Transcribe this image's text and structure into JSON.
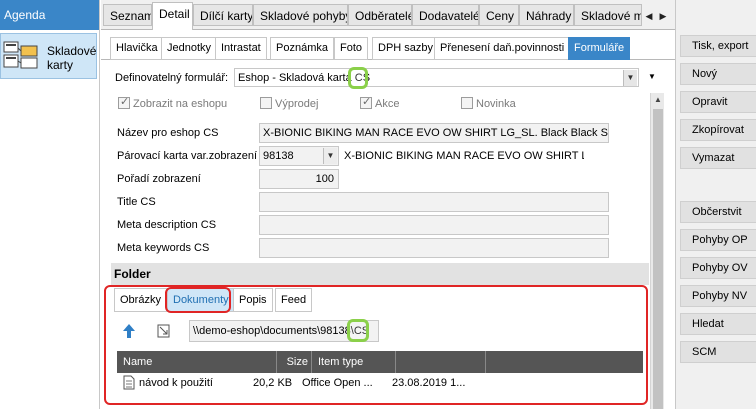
{
  "agenda": {
    "title": "Agenda",
    "item_label_line1": "Skladové",
    "item_label_line2": "karty"
  },
  "top_tabs": [
    {
      "label": "Seznam"
    },
    {
      "label": "Detail"
    },
    {
      "label": "Dílčí karty"
    },
    {
      "label": "Skladové pohyby"
    },
    {
      "label": "Odběratelé"
    },
    {
      "label": "Dodavatelé"
    },
    {
      "label": "Ceny"
    },
    {
      "label": "Náhrady"
    },
    {
      "label": "Skladové me"
    }
  ],
  "sub_tabs": [
    {
      "label": "Hlavička"
    },
    {
      "label": "Jednotky"
    },
    {
      "label": "Intrastat"
    },
    {
      "label": "Poznámka"
    },
    {
      "label": "Foto"
    },
    {
      "label": "DPH sazby"
    },
    {
      "label": "Přenesení daň.povinnosti"
    },
    {
      "label": "Formuláře"
    }
  ],
  "form": {
    "definable_form_label": "Definovatelný formulář:",
    "definable_form_value": "Eshop - Skladová karta CS",
    "checkboxes": [
      {
        "label": "Zobrazit na eshopu",
        "checked": true
      },
      {
        "label": "Výprodej",
        "checked": false
      },
      {
        "label": "Akce",
        "checked": true
      },
      {
        "label": "Novinka",
        "checked": false
      }
    ],
    "name_label": "Název pro eshop CS",
    "name_value": "X-BIONIC BIKING MAN RACE EVO OW SHIRT LG_SL. Black Black S",
    "pairing_label": "Párovací karta var.zobrazení",
    "pairing_code": "98138",
    "pairing_text": "X-BIONIC BIKING MAN RACE EVO OW SHIRT LG_S",
    "order_label": "Pořadí zobrazení",
    "order_value": "100",
    "title_label": "Title CS",
    "title_value": "",
    "meta_desc_label": "Meta description CS",
    "meta_desc_value": "",
    "meta_keywords_label": "Meta keywords CS",
    "meta_keywords_value": ""
  },
  "folder": {
    "header": "Folder",
    "tabs": [
      {
        "label": "Obrázky"
      },
      {
        "label": "Dokumenty"
      },
      {
        "label": "Popis"
      },
      {
        "label": "Feed"
      }
    ],
    "path": "\\\\demo-eshop\\documents\\98138\\CS",
    "columns": [
      {
        "label": "Name"
      },
      {
        "label": "Size"
      },
      {
        "label": "Item type"
      }
    ],
    "row": {
      "name": "návod k použití",
      "size": "20,2 KB",
      "type": "Office Open ...",
      "date": "23.08.2019 1..."
    }
  },
  "actions": [
    {
      "label": "Tisk, export"
    },
    {
      "label": "Nový"
    },
    {
      "label": "Opravit"
    },
    {
      "label": "Zkopírovat"
    },
    {
      "label": "Vymazat"
    },
    {
      "label": "Občerstvit"
    },
    {
      "label": "Pohyby OP"
    },
    {
      "label": "Pohyby OV"
    },
    {
      "label": "Pohyby NV"
    },
    {
      "label": "Hledat"
    },
    {
      "label": "SCM"
    }
  ],
  "colors": {
    "accent_blue": "#3a86c8",
    "highlight_green": "#8bd04a",
    "highlight_red": "#e02525"
  }
}
